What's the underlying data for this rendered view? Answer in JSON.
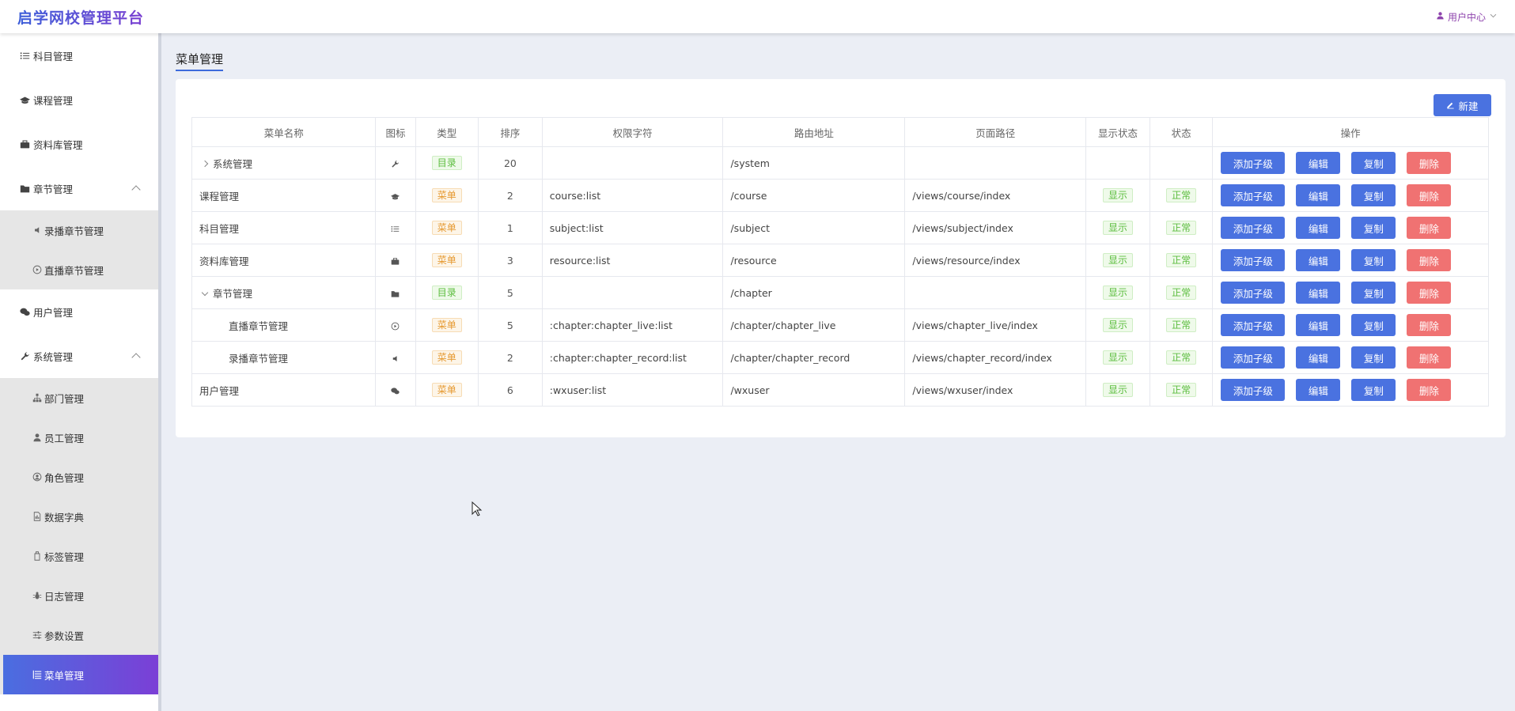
{
  "header": {
    "logo": "启学网校管理平台",
    "user_center": "用户中心"
  },
  "sidebar": {
    "items": [
      {
        "label": "科目管理",
        "icon": "list-icon"
      },
      {
        "label": "课程管理",
        "icon": "graduation-cap-icon"
      },
      {
        "label": "资料库管理",
        "icon": "briefcase-icon"
      },
      {
        "label": "章节管理",
        "icon": "folder-icon",
        "expanded": true,
        "children": [
          {
            "label": "录播章节管理",
            "icon": "volume-icon"
          },
          {
            "label": "直播章节管理",
            "icon": "play-circle-icon"
          }
        ]
      },
      {
        "label": "用户管理",
        "icon": "wechat-icon"
      },
      {
        "label": "系统管理",
        "icon": "wrench-icon",
        "expanded": true,
        "children": [
          {
            "label": "部门管理",
            "icon": "org-icon"
          },
          {
            "label": "员工管理",
            "icon": "user-icon"
          },
          {
            "label": "角色管理",
            "icon": "user-circle-icon"
          },
          {
            "label": "数据字典",
            "icon": "dict-icon"
          },
          {
            "label": "标签管理",
            "icon": "tag-icon"
          },
          {
            "label": "日志管理",
            "icon": "bug-icon"
          },
          {
            "label": "参数设置",
            "icon": "sliders-icon"
          },
          {
            "label": "菜单管理",
            "icon": "tree-list-icon",
            "active": true
          }
        ]
      }
    ]
  },
  "page": {
    "title": "菜单管理",
    "new_button": "新建"
  },
  "table": {
    "headers": [
      "菜单名称",
      "图标",
      "类型",
      "排序",
      "权限字符",
      "路由地址",
      "页面路径",
      "显示状态",
      "状态",
      "操作"
    ],
    "ops": {
      "add_child": "添加子级",
      "edit": "编辑",
      "copy": "复制",
      "delete": "删除"
    },
    "rows": [
      {
        "name": "系统管理",
        "icon": "wrench-icon",
        "type": "目录",
        "order": "20",
        "perm": "",
        "route": "/system",
        "path": "",
        "visible": "",
        "status": ""
      },
      {
        "name": "课程管理",
        "icon": "graduation-cap-icon",
        "type": "菜单",
        "order": "2",
        "perm": "course:list",
        "route": "/course",
        "path": "/views/course/index",
        "visible": "显示",
        "status": "正常"
      },
      {
        "name": "科目管理",
        "icon": "list-icon",
        "type": "菜单",
        "order": "1",
        "perm": "subject:list",
        "route": "/subject",
        "path": "/views/subject/index",
        "visible": "显示",
        "status": "正常"
      },
      {
        "name": "资料库管理",
        "icon": "briefcase-icon",
        "type": "菜单",
        "order": "3",
        "perm": "resource:list",
        "route": "/resource",
        "path": "/views/resource/index",
        "visible": "显示",
        "status": "正常"
      },
      {
        "name": "章节管理",
        "icon": "folder-icon",
        "type": "目录",
        "order": "5",
        "perm": "",
        "route": "/chapter",
        "path": "",
        "visible": "显示",
        "status": "正常"
      },
      {
        "name": "直播章节管理",
        "icon": "play-circle-icon",
        "type": "菜单",
        "order": "5",
        "perm": ":chapter:chapter_live:list",
        "route": "/chapter/chapter_live",
        "path": "/views/chapter_live/index",
        "visible": "显示",
        "status": "正常"
      },
      {
        "name": "录播章节管理",
        "icon": "volume-icon",
        "type": "菜单",
        "order": "2",
        "perm": ":chapter:chapter_record:list",
        "route": "/chapter/chapter_record",
        "path": "/views/chapter_record/index",
        "visible": "显示",
        "status": "正常"
      },
      {
        "name": "用户管理",
        "icon": "wechat-icon",
        "type": "菜单",
        "order": "6",
        "perm": ":wxuser:list",
        "route": "/wxuser",
        "path": "/views/wxuser/index",
        "visible": "显示",
        "status": "正常"
      }
    ]
  }
}
